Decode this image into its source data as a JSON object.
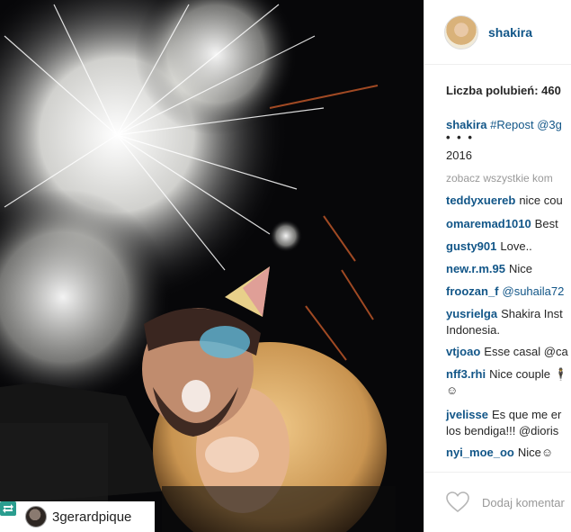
{
  "repost": {
    "username": "3gerardpique"
  },
  "post": {
    "username": "shakira",
    "likes_text": "Liczba polubień: 460",
    "caption_user": "shakira",
    "caption_text": "#Repost @3g",
    "ellipsis": "• • •",
    "year": "2016",
    "view_all": "zobacz wszystkie kom",
    "comments": [
      {
        "user": "teddyxuereb",
        "text": "nice cou"
      },
      {
        "user": "omaremad1010",
        "text": "Best"
      },
      {
        "user": "gusty901",
        "text": "Love.."
      },
      {
        "user": "new.r.m.95",
        "text": "Nice"
      },
      {
        "user": "froozan_f",
        "text": "@suhaila72"
      },
      {
        "user": "yusrielga",
        "text": "Shakira Inst",
        "text2": "Indonesia."
      },
      {
        "user": "vtjoao",
        "text": "Esse casal @ca"
      },
      {
        "user": "nff3.rhi",
        "text": "Nice couple 🕴",
        "text2": "☺"
      },
      {
        "user": "jvelisse",
        "text": "Es que me er",
        "text2": "los bendiga!!! @dioris"
      },
      {
        "user": "nyi_moe_oo",
        "text": "Nice☺"
      }
    ],
    "add_comment_placeholder": "Dodaj komentar"
  },
  "colors": {
    "link": "#125688",
    "text": "#262626",
    "muted": "#999999"
  },
  "icons": [
    "repost-icon",
    "heart-icon"
  ]
}
